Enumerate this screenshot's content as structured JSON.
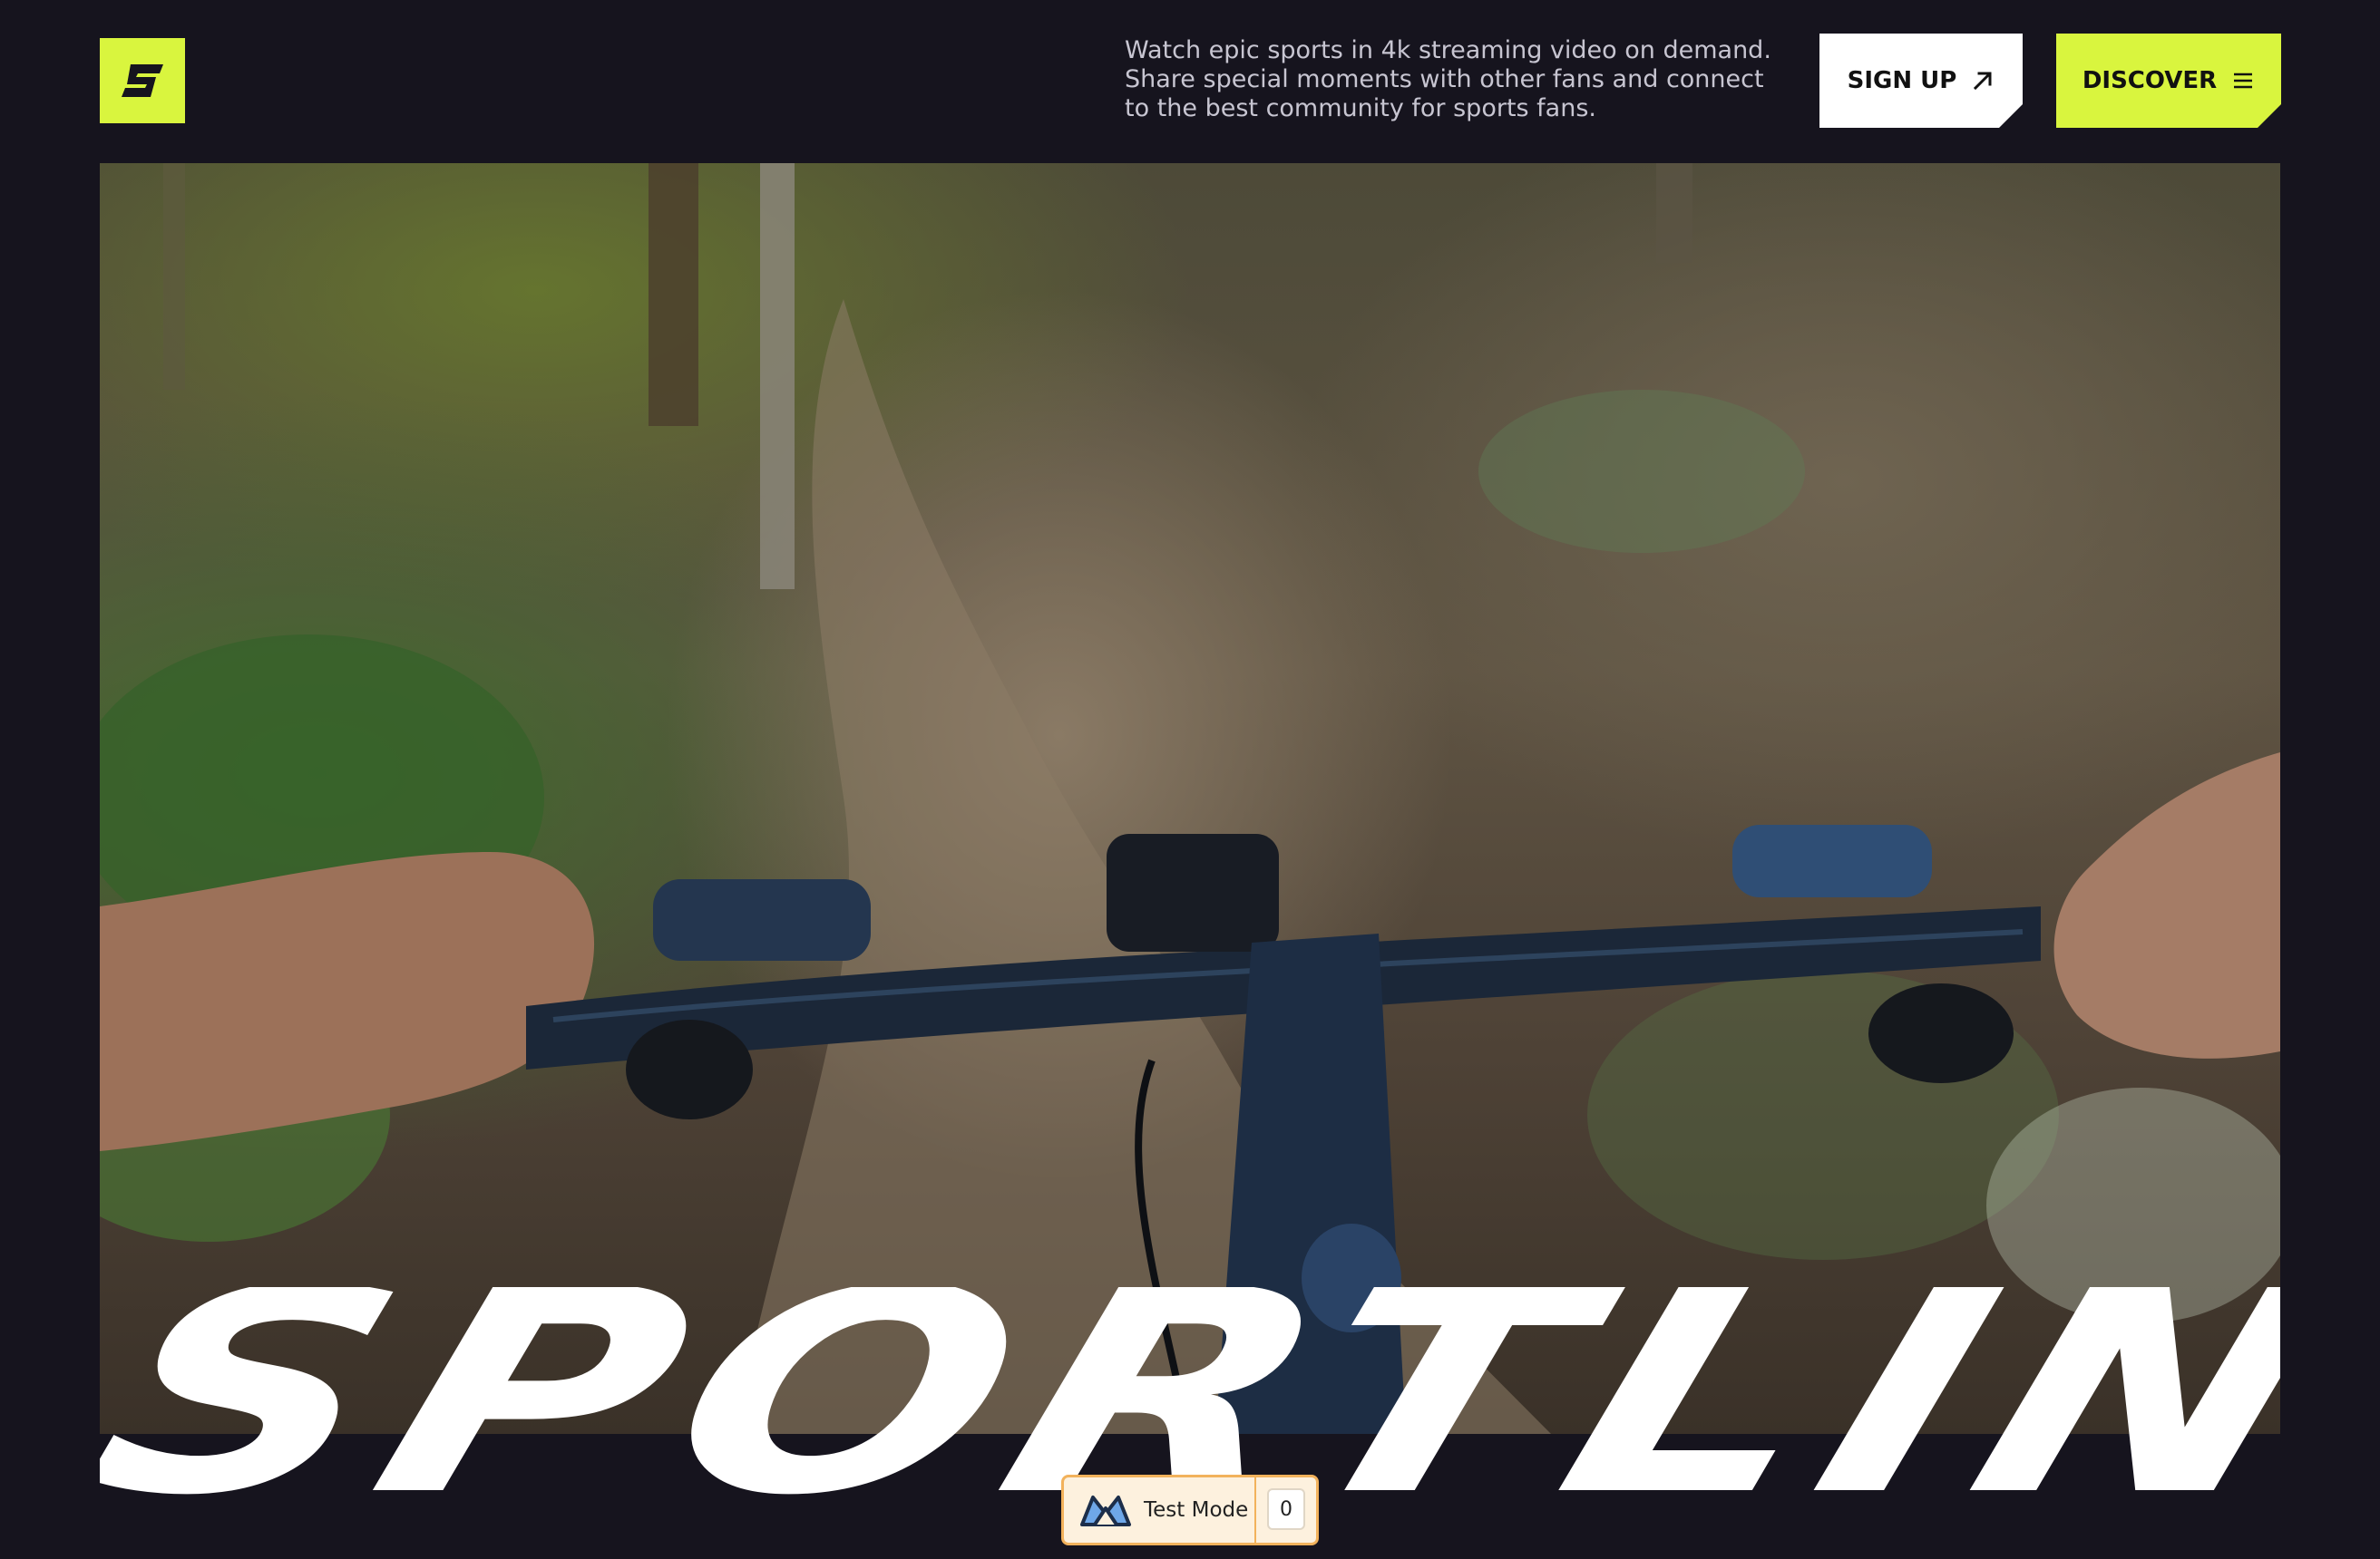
{
  "brand": {
    "logo_icon": "sportlink-s-logo-icon",
    "accent": "#d9f53e",
    "background": "#16141e"
  },
  "header": {
    "tagline": "Watch epic sports in 4k streaming video on demand. Share special moments with other fans and connect to the best community for sports fans.",
    "signup_label": "SIGN UP",
    "signup_icon": "arrow-up-right-icon",
    "discover_label": "DISCOVER",
    "discover_icon": "menu-icon"
  },
  "hero": {
    "media": "mountain-bike-trail-video"
  },
  "wordmark": {
    "text": "SPORTLINK"
  },
  "test_mode": {
    "label": "Test Mode",
    "count": "0",
    "icon": "test-mode-logo-icon"
  }
}
